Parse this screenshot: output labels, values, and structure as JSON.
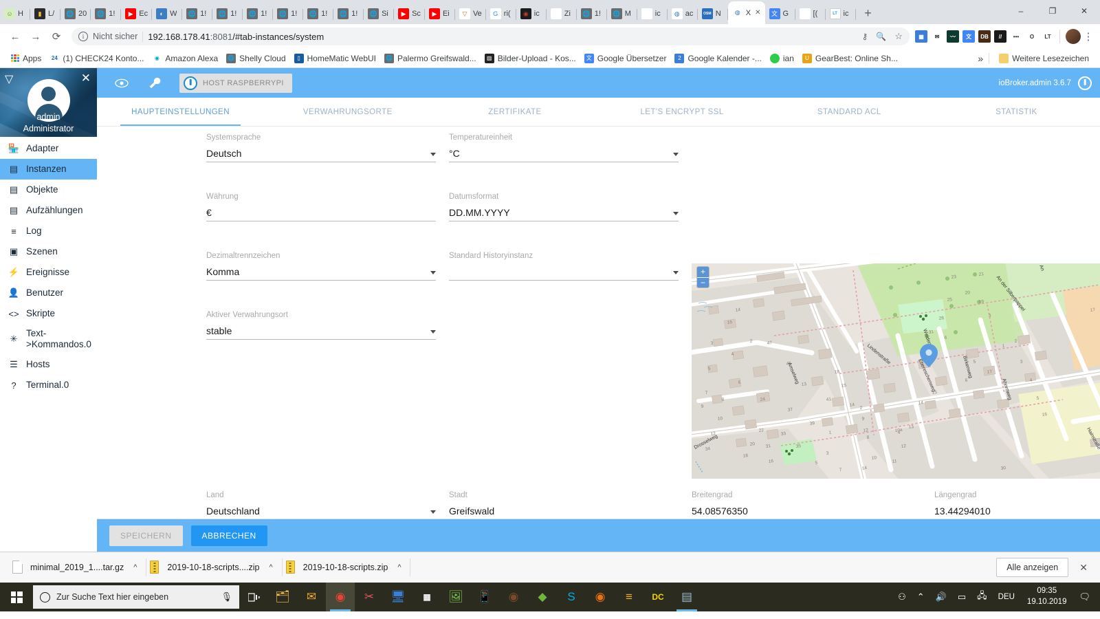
{
  "browser": {
    "tabs": [
      {
        "title": "H",
        "icon": "smiley-icon",
        "color": "#d9edc2",
        "glyph": "☺",
        "fg": "#4c8c1f"
      },
      {
        "title": "L/",
        "icon": "bag-icon",
        "color": "#2b2b2b",
        "glyph": "▮",
        "fg": "#f0c040"
      },
      {
        "title": "20",
        "icon": "globe-icon",
        "color": "#6b6b6b",
        "glyph": "🌐",
        "fg": "#fff"
      },
      {
        "title": "1!",
        "icon": "globe-icon",
        "color": "#6b6b6b",
        "glyph": "🌐",
        "fg": "#fff"
      },
      {
        "title": "Ec",
        "icon": "youtube-icon",
        "color": "#ff0000",
        "glyph": "▶",
        "fg": "#fff"
      },
      {
        "title": "W",
        "icon": "info-circle-icon",
        "color": "#3c7ebf",
        "glyph": "◐",
        "fg": "#fff"
      },
      {
        "title": "1!",
        "icon": "globe-icon",
        "color": "#6b6b6b",
        "glyph": "🌐",
        "fg": "#fff"
      },
      {
        "title": "1!",
        "icon": "globe-icon",
        "color": "#6b6b6b",
        "glyph": "🌐",
        "fg": "#fff"
      },
      {
        "title": "1!",
        "icon": "globe-icon",
        "color": "#6b6b6b",
        "glyph": "🌐",
        "fg": "#fff"
      },
      {
        "title": "1!",
        "icon": "globe-icon",
        "color": "#6b6b6b",
        "glyph": "🌐",
        "fg": "#fff"
      },
      {
        "title": "1!",
        "icon": "globe-icon",
        "color": "#6b6b6b",
        "glyph": "🌐",
        "fg": "#fff"
      },
      {
        "title": "1!",
        "icon": "globe-icon",
        "color": "#6b6b6b",
        "glyph": "🌐",
        "fg": "#fff"
      },
      {
        "title": "Si",
        "icon": "globe-icon",
        "color": "#6b6b6b",
        "glyph": "🌐",
        "fg": "#fff"
      },
      {
        "title": "Sc",
        "icon": "youtube-icon",
        "color": "#ff0000",
        "glyph": "▶",
        "fg": "#fff"
      },
      {
        "title": "Ei",
        "icon": "youtube-icon",
        "color": "#ff0000",
        "glyph": "▶",
        "fg": "#fff"
      },
      {
        "title": "Ve",
        "icon": "vlc-cone-icon",
        "color": "#ffffff",
        "glyph": "▽",
        "fg": "#e8720c"
      },
      {
        "title": "ri(",
        "icon": "google-icon",
        "color": "#ffffff",
        "glyph": "G",
        "fg": "#4285f4"
      },
      {
        "title": "ic",
        "icon": "dark-square-icon",
        "color": "#1c1c1c",
        "glyph": "◉",
        "fg": "#c0392b"
      },
      {
        "title": "Zi",
        "icon": "blank-icon",
        "color": "#ffffff",
        "glyph": "",
        "fg": "#555"
      },
      {
        "title": "1!",
        "icon": "globe-icon",
        "color": "#6b6b6b",
        "glyph": "🌐",
        "fg": "#fff"
      },
      {
        "title": "M",
        "icon": "globe-icon",
        "color": "#6b6b6b",
        "glyph": "🌐",
        "fg": "#fff"
      },
      {
        "title": "ic",
        "icon": "blank-icon",
        "color": "#ffffff",
        "glyph": "",
        "fg": "#555"
      },
      {
        "title": "ac",
        "icon": "iobroker-icon",
        "color": "#ffffff",
        "glyph": "◍",
        "fg": "#3a78b5"
      },
      {
        "title": "N",
        "icon": "osm-icon",
        "color": "#2d6fbf",
        "glyph": "OSM",
        "fg": "#fff"
      },
      {
        "title": "X",
        "icon": "iobroker-icon",
        "color": "#ffffff",
        "glyph": "◍",
        "fg": "#3a78b5",
        "active": true
      },
      {
        "title": "G",
        "icon": "google-translate-icon",
        "color": "#4285f4",
        "glyph": "文",
        "fg": "#fff"
      },
      {
        "title": "[(",
        "icon": "blank-icon",
        "color": "#ffffff",
        "glyph": "",
        "fg": "#555"
      },
      {
        "title": "ic",
        "icon": "lt-blog-icon",
        "color": "#ffffff",
        "glyph": "LT",
        "fg": "#2aa6d8"
      }
    ],
    "new_tab_label": "+",
    "window_controls": {
      "minimize": "–",
      "maximize": "❐",
      "close": "✕"
    },
    "nav": {
      "back": "←",
      "forward": "→",
      "reload": "⟳"
    },
    "omnibox": {
      "info_icon": "ⓘ",
      "security_text": "Nicht sicher",
      "url_host": "192.168.178.41",
      "url_port": ":8081",
      "url_path": "/#tab-instances/system"
    },
    "omnibox_actions": {
      "key": "⚷",
      "zoom": "🔍",
      "bookmark": "☆"
    },
    "extensions": [
      {
        "name": "blue-grid-extension",
        "color": "#3b7dd8",
        "glyph": "▦"
      },
      {
        "name": "mail-extension",
        "color": "#ffffff",
        "glyph": "✉"
      },
      {
        "name": "dark-green-extension",
        "color": "#0d3b2e",
        "glyph": "〰"
      },
      {
        "name": "google-translate-extension",
        "color": "#4285f4",
        "glyph": "文"
      },
      {
        "name": "db-extension",
        "color": "#4a2c14",
        "glyph": "DB"
      },
      {
        "name": "red-stripes-extension",
        "color": "#1a1a1a",
        "glyph": "//"
      },
      {
        "name": "more-extension",
        "color": "#ffffff",
        "glyph": "•••"
      },
      {
        "name": "opera-extension",
        "color": "#ffffff",
        "glyph": "O"
      },
      {
        "name": "languagetool-extension",
        "color": "#ffffff",
        "glyph": "LT"
      }
    ],
    "profile_icon": "avatar",
    "menu_icon": "⋮",
    "bookmarks": [
      {
        "label": "Apps",
        "icon": "apps-grid-icon",
        "color": "",
        "glyph": ""
      },
      {
        "label": "(1) CHECK24 Konto...",
        "icon": "check24-icon",
        "color": "#ffffff",
        "glyph": "24",
        "fg": "#1c6fb8"
      },
      {
        "label": "Amazon Alexa",
        "icon": "location-pin-icon",
        "color": "#ffffff",
        "glyph": "◉",
        "fg": "#00a8c0"
      },
      {
        "label": "Shelly Cloud",
        "icon": "globe-icon",
        "color": "#6b6b6b",
        "glyph": "🌐",
        "fg": "#fff"
      },
      {
        "label": "HomeMatic WebUI",
        "icon": "device-icon",
        "color": "#1a5a9e",
        "glyph": "▯",
        "fg": "#fff"
      },
      {
        "label": "Palermo Greifswald...",
        "icon": "globe-icon",
        "color": "#6b6b6b",
        "glyph": "🌐",
        "fg": "#fff"
      },
      {
        "label": "Bilder-Upload - Kos...",
        "icon": "image-icon",
        "color": "#222222",
        "glyph": "▨",
        "fg": "#fff"
      },
      {
        "label": "Google Übersetzer",
        "icon": "google-translate-icon",
        "color": "#4285f4",
        "glyph": "文",
        "fg": "#fff"
      },
      {
        "label": "Google Kalender -...",
        "icon": "calendar-icon",
        "color": "#3b7dd8",
        "glyph": "2",
        "fg": "#fff"
      },
      {
        "label": "ian",
        "icon": "green-dot-icon",
        "color": "#2ecc4b",
        "glyph": "",
        "fg": "#fff"
      },
      {
        "label": "GearBest: Online Sh...",
        "icon": "gearbest-icon",
        "color": "#e8a317",
        "glyph": "U",
        "fg": "#fff"
      }
    ],
    "bookmarks_overflow": "»",
    "other_bookmarks": {
      "label": "Weitere Lesezeichen",
      "icon": "folder-icon"
    }
  },
  "app": {
    "toolbar": {
      "eye_icon": "eye-icon",
      "wrench_icon": "wrench-icon",
      "host_chip": "HOST RASPBERRYPI",
      "version": "ioBroker.admin 3.6.7"
    },
    "sidebar": {
      "collapse_icon": "▽",
      "close_icon": "✕",
      "user": "admin",
      "role": "Administrator",
      "items": [
        {
          "label": "Adapter",
          "icon": "store-icon",
          "glyph": "🏪"
        },
        {
          "label": "Instanzen",
          "icon": "instances-icon",
          "glyph": "▤",
          "selected": true
        },
        {
          "label": "Objekte",
          "icon": "objects-icon",
          "glyph": "▤"
        },
        {
          "label": "Aufzählungen",
          "icon": "enums-icon",
          "glyph": "▤"
        },
        {
          "label": "Log",
          "icon": "log-icon",
          "glyph": "≡"
        },
        {
          "label": "Szenen",
          "icon": "scenes-icon",
          "glyph": "▣"
        },
        {
          "label": "Ereignisse",
          "icon": "events-icon",
          "glyph": "⚡"
        },
        {
          "label": "Benutzer",
          "icon": "users-icon",
          "glyph": "👤"
        },
        {
          "label": "Skripte",
          "icon": "scripts-icon",
          "glyph": "<>"
        },
        {
          "label": "Text->Kommandos.0",
          "icon": "snowflake-icon",
          "glyph": "✳"
        },
        {
          "label": "Hosts",
          "icon": "hosts-icon",
          "glyph": "☰"
        },
        {
          "label": "Terminal.0",
          "icon": "terminal-icon",
          "glyph": "?"
        }
      ]
    },
    "tabs": [
      {
        "label": "HAUPTEINSTELLUNGEN",
        "active": true
      },
      {
        "label": "VERWAHRUNGSORTE",
        "active": false
      },
      {
        "label": "ZERTIFIKATE",
        "active": false
      },
      {
        "label": "LET'S ENCRYPT SSL",
        "active": false
      },
      {
        "label": "STANDARD ACL",
        "active": false
      },
      {
        "label": "STATISTIK",
        "active": false
      }
    ],
    "form": {
      "systemsprache": {
        "label": "Systemsprache",
        "value": "Deutsch",
        "type": "select"
      },
      "temperatureinheit": {
        "label": "Temperatureinheit",
        "value": "°C",
        "type": "select"
      },
      "waehrung": {
        "label": "Währung",
        "value": "€",
        "type": "text"
      },
      "datumsformat": {
        "label": "Datumsformat",
        "value": "DD.MM.YYYY",
        "type": "select"
      },
      "dezimaltrennzeichen": {
        "label": "Dezimaltrennzeichen",
        "value": "Komma",
        "type": "select"
      },
      "historyinstanz": {
        "label": "Standard Historyinstanz",
        "value": "",
        "type": "select"
      },
      "verwahrungsort": {
        "label": "Aktiver Verwahrungsort",
        "value": "stable",
        "type": "select"
      },
      "land": {
        "label": "Land",
        "value": "Deutschland",
        "type": "select"
      },
      "stadt": {
        "label": "Stadt",
        "value": "Greifswald",
        "type": "text"
      },
      "breitengrad": {
        "label": "Breitengrad",
        "value": "54.08576350",
        "type": "text"
      },
      "laengengrad": {
        "label": "Längengrad",
        "value": "13.44294010",
        "type": "text"
      }
    },
    "map": {
      "zoom_in": "+",
      "zoom_out": "−",
      "info": "i",
      "streets": [
        "Amselweg",
        "Lindenstraße",
        "An der Silberpappel",
        "Weidenweg",
        "Ebereschenweg",
        "Birkenweg",
        "Ahornweg",
        "Hainstraße",
        "Drosselweg"
      ],
      "house_numbers": [
        "14",
        "16",
        "3",
        "5",
        "7",
        "9",
        "2",
        "4",
        "6",
        "8",
        "10",
        "12",
        "24",
        "47",
        "45",
        "13",
        "41",
        "37",
        "39",
        "1",
        "33",
        "35",
        "22",
        "20",
        "31",
        "29",
        "18",
        "16",
        "21",
        "25",
        "27",
        "5",
        "3",
        "7",
        "23",
        "21",
        "20",
        "19",
        "18",
        "17",
        "28",
        "30",
        "26",
        "25",
        "23a",
        "23c",
        "28a",
        "27",
        "10a",
        "12"
      ]
    },
    "footer": {
      "save": "SPEICHERN",
      "cancel": "ABBRECHEN"
    }
  },
  "downloads": {
    "items": [
      {
        "name": "minimal_2019_1....tar.gz",
        "icon": "file-icon",
        "caret": "^"
      },
      {
        "name": "2019-10-18-scripts....zip",
        "icon": "zip-icon",
        "caret": "^"
      },
      {
        "name": "2019-10-18-scripts.zip",
        "icon": "zip-icon",
        "caret": "^"
      }
    ],
    "show_all": "Alle anzeigen",
    "close": "✕"
  },
  "taskbar": {
    "start_icon": "windows-icon",
    "search_placeholder": "Zur Suche Text hier eingeben",
    "mic_icon": "microphone-icon",
    "taskview_icon": "task-view-icon",
    "apps": [
      {
        "name": "file-explorer",
        "glyph": "🗂",
        "color": "#ffc94d"
      },
      {
        "name": "mail-client",
        "glyph": "✉",
        "color": "#f0a830"
      },
      {
        "name": "google-chrome",
        "glyph": "◉",
        "color": "#ea4335",
        "running": true,
        "active": true
      },
      {
        "name": "paint-tool",
        "glyph": "✂",
        "color": "#e05555"
      },
      {
        "name": "remote-desktop",
        "glyph": "🖥",
        "color": "#3a7fd5"
      },
      {
        "name": "calculator",
        "glyph": "▦",
        "color": "#f2f2f2"
      },
      {
        "name": "photo-viewer",
        "glyph": "🖼",
        "color": "#7fcf4d"
      },
      {
        "name": "phone-link",
        "glyph": "📱",
        "color": "#3ba6e0"
      },
      {
        "name": "audio-app",
        "glyph": "◉",
        "color": "#7a4a2a"
      },
      {
        "name": "green-diamond-app",
        "glyph": "◆",
        "color": "#6ab93a"
      },
      {
        "name": "skype",
        "glyph": "S",
        "color": "#00aff0"
      },
      {
        "name": "firefox",
        "glyph": "◉",
        "color": "#e8720c"
      },
      {
        "name": "winamp",
        "glyph": "≡",
        "color": "#e8b020"
      },
      {
        "name": "dc19-app",
        "glyph": "DC",
        "color": "#f5d400"
      },
      {
        "name": "notes-app",
        "glyph": "▤",
        "color": "#9bb8cc",
        "running": true
      }
    ],
    "tray": [
      {
        "name": "people-icon",
        "glyph": "⚇"
      },
      {
        "name": "show-hidden-icons",
        "glyph": "⌃"
      },
      {
        "name": "volume-icon",
        "glyph": "🔊"
      },
      {
        "name": "battery-icon",
        "glyph": "▭"
      },
      {
        "name": "network-icon",
        "glyph": "🖧"
      },
      {
        "name": "language-indicator",
        "glyph": "DEU"
      }
    ],
    "clock_time": "09:35",
    "clock_date": "19.10.2019",
    "notification_icon": "🗨"
  }
}
